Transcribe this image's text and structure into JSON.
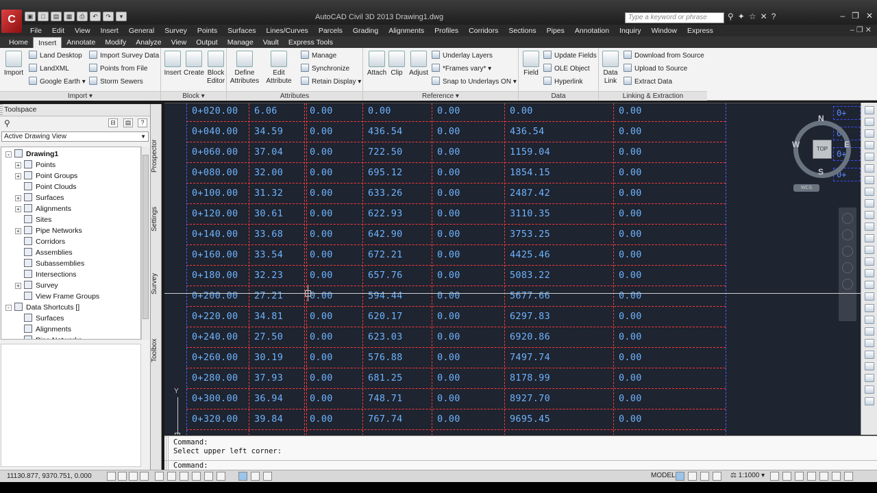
{
  "app": {
    "logo_letter": "C",
    "window_title": "AutoCAD Civil 3D 2013   Drawing1.dwg",
    "search_placeholder": "Type a keyword or phrase"
  },
  "menu": [
    "File",
    "Edit",
    "View",
    "Insert",
    "General",
    "Survey",
    "Points",
    "Surfaces",
    "Lines/Curves",
    "Parcels",
    "Grading",
    "Alignments",
    "Profiles",
    "Corridors",
    "Sections",
    "Pipes",
    "Annotation",
    "Inquiry",
    "Window",
    "Express"
  ],
  "ribbon_tabs": [
    "Home",
    "Insert",
    "Annotate",
    "Modify",
    "Analyze",
    "View",
    "Output",
    "Manage",
    "Vault",
    "Express Tools"
  ],
  "ribbon_active_tab": "Insert",
  "ribbon": {
    "import": {
      "title": "Import",
      "big": "Import",
      "items": [
        "Land Desktop",
        "LandXML",
        "Google Earth",
        "Import Survey Data",
        "Points from File",
        "Storm Sewers"
      ]
    },
    "block": {
      "title": "Block",
      "insert": "Insert",
      "create": "Create",
      "block_editor_1": "Block",
      "block_editor_2": "Editor"
    },
    "attributes": {
      "title": "Attributes",
      "define_1": "Define",
      "define_2": "Attributes",
      "edit_1": "Edit",
      "edit_2": "Attribute",
      "items": [
        "Manage",
        "Synchronize",
        "Retain Display"
      ]
    },
    "reference": {
      "title": "Reference",
      "attach": "Attach",
      "clip": "Clip",
      "adjust": "Adjust",
      "items": [
        "Underlay Layers",
        "*Frames vary*",
        "Snap to Underlays ON"
      ]
    },
    "data": {
      "title": "Data",
      "field": "Field",
      "items": [
        "Update Fields",
        "OLE Object",
        "Hyperlink"
      ]
    },
    "linking": {
      "title": "Linking & Extraction",
      "data_link_1": "Data",
      "data_link_2": "Link",
      "items": [
        "Download from Source",
        "Upload to Source",
        "Extract  Data"
      ]
    }
  },
  "toolspace": {
    "title": "Toolspace",
    "view_select": "Active Drawing View",
    "tree": [
      {
        "label": "Drawing1",
        "level": 0,
        "exp": "-",
        "bold": true
      },
      {
        "label": "Points",
        "level": 1,
        "exp": "+"
      },
      {
        "label": "Point Groups",
        "level": 1,
        "exp": "+"
      },
      {
        "label": "Point Clouds",
        "level": 1,
        "exp": ""
      },
      {
        "label": "Surfaces",
        "level": 1,
        "exp": "+"
      },
      {
        "label": "Alignments",
        "level": 1,
        "exp": "+"
      },
      {
        "label": "Sites",
        "level": 1,
        "exp": ""
      },
      {
        "label": "Pipe Networks",
        "level": 1,
        "exp": "+"
      },
      {
        "label": "Corridors",
        "level": 1,
        "exp": ""
      },
      {
        "label": "Assemblies",
        "level": 1,
        "exp": ""
      },
      {
        "label": "Subassemblies",
        "level": 1,
        "exp": ""
      },
      {
        "label": "Intersections",
        "level": 1,
        "exp": ""
      },
      {
        "label": "Survey",
        "level": 1,
        "exp": "+"
      },
      {
        "label": "View Frame Groups",
        "level": 1,
        "exp": ""
      },
      {
        "label": "Data Shortcuts []",
        "level": 0,
        "exp": "-"
      },
      {
        "label": "Surfaces",
        "level": 1,
        "exp": ""
      },
      {
        "label": "Alignments",
        "level": 1,
        "exp": ""
      },
      {
        "label": "Pipe Networks",
        "level": 1,
        "exp": ""
      }
    ],
    "vtabs": [
      "Prospector",
      "Settings",
      "Survey",
      "Toolbox"
    ]
  },
  "table": {
    "rows": [
      [
        "0+020.00",
        "6.06",
        "0.00",
        "0.00",
        "0.00",
        "0.00",
        "0.00"
      ],
      [
        "0+040.00",
        "34.59",
        "0.00",
        "436.54",
        "0.00",
        "436.54",
        "0.00"
      ],
      [
        "0+060.00",
        "37.04",
        "0.00",
        "722.50",
        "0.00",
        "1159.04",
        "0.00"
      ],
      [
        "0+080.00",
        "32.00",
        "0.00",
        "695.12",
        "0.00",
        "1854.15",
        "0.00"
      ],
      [
        "0+100.00",
        "31.32",
        "0.00",
        "633.26",
        "0.00",
        "2487.42",
        "0.00"
      ],
      [
        "0+120.00",
        "30.61",
        "0.00",
        "622.93",
        "0.00",
        "3110.35",
        "0.00"
      ],
      [
        "0+140.00",
        "33.68",
        "0.00",
        "642.90",
        "0.00",
        "3753.25",
        "0.00"
      ],
      [
        "0+160.00",
        "33.54",
        "0.00",
        "672.21",
        "0.00",
        "4425.46",
        "0.00"
      ],
      [
        "0+180.00",
        "32.23",
        "0.00",
        "657.76",
        "0.00",
        "5083.22",
        "0.00"
      ],
      [
        "0+200.00",
        "27.21",
        "0.00",
        "594.44",
        "0.00",
        "5677.66",
        "0.00"
      ],
      [
        "0+220.00",
        "34.81",
        "0.00",
        "620.17",
        "0.00",
        "6297.83",
        "0.00"
      ],
      [
        "0+240.00",
        "27.50",
        "0.00",
        "623.03",
        "0.00",
        "6920.86",
        "0.00"
      ],
      [
        "0+260.00",
        "30.19",
        "0.00",
        "576.88",
        "0.00",
        "7497.74",
        "0.00"
      ],
      [
        "0+280.00",
        "37.93",
        "0.00",
        "681.25",
        "0.00",
        "8178.99",
        "0.00"
      ],
      [
        "0+300.00",
        "36.94",
        "0.00",
        "748.71",
        "0.00",
        "8927.70",
        "0.00"
      ],
      [
        "0+320.00",
        "39.84",
        "0.00",
        "767.74",
        "0.00",
        "9695.45",
        "0.00"
      ]
    ],
    "edge_labels": [
      "0+",
      "0+",
      "0+",
      "0+"
    ]
  },
  "viewcube": {
    "n": "N",
    "s": "S",
    "e": "E",
    "w": "W",
    "top": "TOP",
    "wcs": "WCS"
  },
  "ucs": {
    "y": "Y"
  },
  "command": {
    "history_1": "Command:",
    "history_2": "Select upper left corner:",
    "prompt": "Command:"
  },
  "status": {
    "coords": "11130.877, 9370.751, 0.000",
    "model": "MODEL",
    "scale": "1:1000"
  }
}
